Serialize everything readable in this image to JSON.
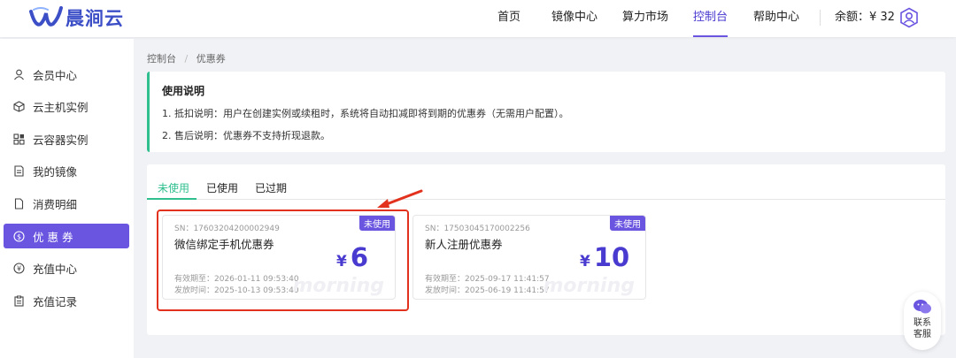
{
  "brand": {
    "name": "晨涧云"
  },
  "nav": {
    "items": [
      {
        "label": "首页"
      },
      {
        "label": "镜像中心"
      },
      {
        "label": "算力市场"
      },
      {
        "label": "控制台"
      },
      {
        "label": "帮助中心"
      }
    ],
    "active": "控制台",
    "balance": "余额：¥ 32"
  },
  "sidebar": {
    "items": [
      {
        "label": "会员中心",
        "icon": "user-icon"
      },
      {
        "label": "云主机实例",
        "icon": "cube-icon"
      },
      {
        "label": "云容器实例",
        "icon": "grid-icon"
      },
      {
        "label": "我的镜像",
        "icon": "image-icon"
      },
      {
        "label": "消费明细",
        "icon": "document-icon"
      },
      {
        "label": "优 惠 券",
        "icon": "coupon-icon"
      },
      {
        "label": "充值中心",
        "icon": "yen-icon"
      },
      {
        "label": "充值记录",
        "icon": "clipboard-icon"
      }
    ],
    "active_index": 5
  },
  "breadcrumb": {
    "root": "控制台",
    "sep": "/",
    "current": "优惠券"
  },
  "notice": {
    "title": "使用说明",
    "lines": [
      "1. 抵扣说明：用户在创建实例或续租时，系统将自动扣减即将到期的优惠券（无需用户配置）。",
      "2. 售后说明：优惠券不支持折现退款。"
    ]
  },
  "tabs": [
    {
      "label": "未使用"
    },
    {
      "label": "已使用"
    },
    {
      "label": "已过期"
    }
  ],
  "coupons": [
    {
      "badge": "未使用",
      "sn": "SN：17603204200002949",
      "name": "微信绑定手机优惠券",
      "currency": "¥",
      "amount": "6",
      "expires": "有效期至：2026-01-11 09:53:40",
      "issued": "发放时间：2025-10-13 09:53:40",
      "watermark": "morning"
    },
    {
      "badge": "未使用",
      "sn": "SN：17503045170002256",
      "name": "新人注册优惠券",
      "currency": "¥",
      "amount": "10",
      "expires": "有效期至：2025-09-17 11:41:57",
      "issued": "发放时间：2025-06-19 11:41:57",
      "watermark": "morning"
    }
  ],
  "contact": {
    "label": "联系客服"
  },
  "colors": {
    "brand": "#3d4fc7",
    "accent": "#6a55e0",
    "tab_active": "#2fbf8f",
    "annotation": "#e2321e"
  }
}
